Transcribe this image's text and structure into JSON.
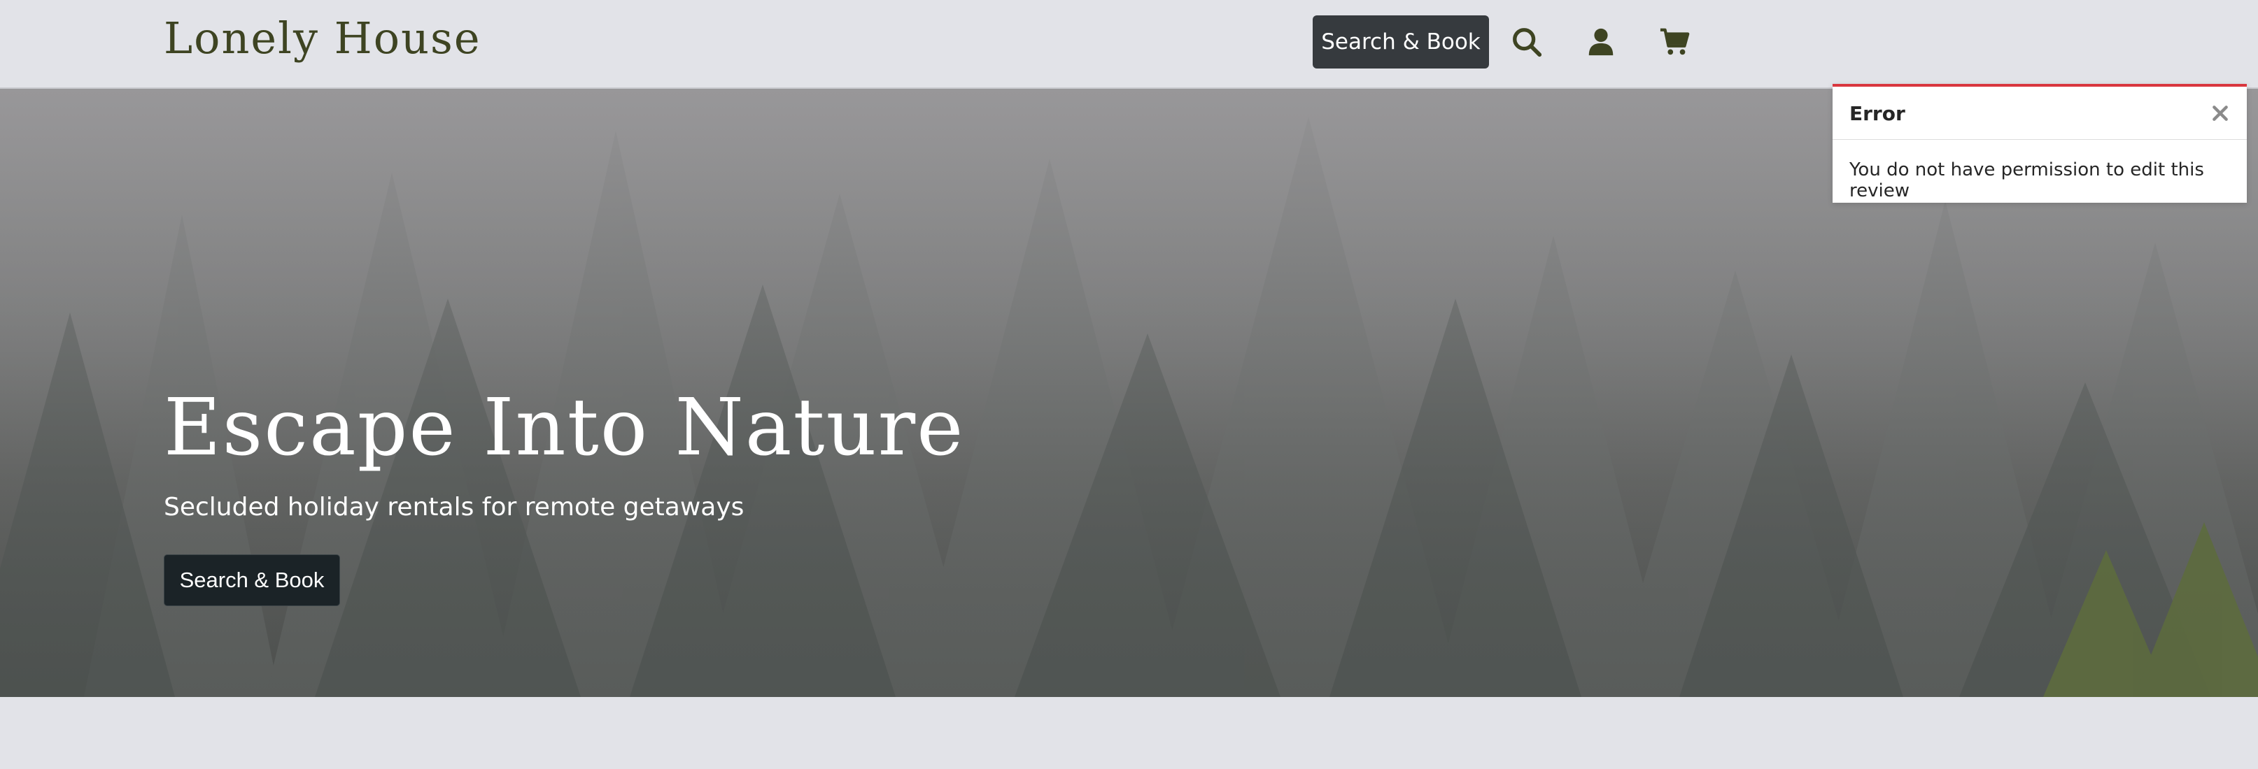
{
  "header": {
    "logo": "Lonely House",
    "cta_label": "Search & Book",
    "icons": [
      "search-icon",
      "user-icon",
      "cart-icon"
    ]
  },
  "hero": {
    "title": "Escape Into Nature",
    "subtitle": "Secluded holiday rentals for remote getaways",
    "cta_label": "Search & Book"
  },
  "toast": {
    "title": "Error",
    "message": "You do not have permission to edit this review",
    "close_icon": "close-icon",
    "accent_color": "#d9363e"
  },
  "colors": {
    "brand": "#3e4422",
    "nav_button": "#363a3e",
    "hero_button": "#1b2327",
    "page_bg": "#e2e3e8"
  }
}
